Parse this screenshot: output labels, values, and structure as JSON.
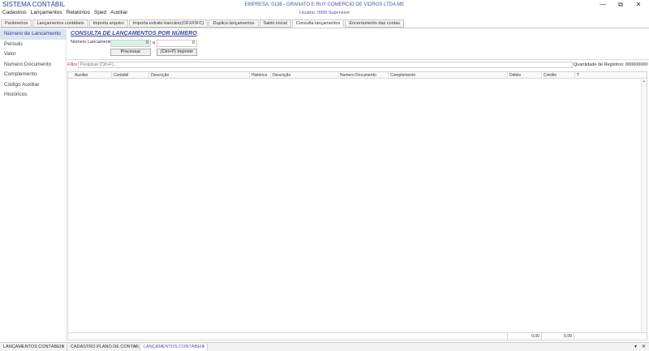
{
  "app": {
    "title": "SISTEMA CONTÁBIL",
    "company": "EMPRESA: 0138 - GRANATO E RUY COMERCIO DE VIDROS LTDA ME",
    "user": "Usuário: 9999 Supervisor"
  },
  "window_controls": {
    "minimize": "—",
    "restore": "⧉",
    "close": "✕"
  },
  "menu": [
    "Cadastros",
    "Lançamentos",
    "Relatórios",
    "Sped",
    "Auxiliar"
  ],
  "tabs": [
    {
      "label": "Parâmetros"
    },
    {
      "label": "Lançamentos contábeis"
    },
    {
      "label": "Importa arquivo"
    },
    {
      "label": "Importa extrato bancário(OFX/OFC)"
    },
    {
      "label": "Duplica lançamentos"
    },
    {
      "label": "Saldo inicial"
    },
    {
      "label": "Consulta lançamentos"
    },
    {
      "label": "Encerramento das contas"
    }
  ],
  "sidebar": [
    {
      "label": "Número de Lancamento"
    },
    {
      "label": "Período"
    },
    {
      "label": "Valor"
    },
    {
      "label": "Numero Documento"
    },
    {
      "label": "Complemento"
    },
    {
      "label": "Código Auxiliar"
    },
    {
      "label": "Históricos"
    }
  ],
  "form": {
    "section_title": "CONSULTA DE LANÇAMENTOS POR NÚMERO",
    "field_label": "Número Lancamento:",
    "from_value": "0",
    "separator": "a",
    "to_value": "0",
    "process_button": "Processar",
    "print_button": "(Ctrl+P) Imprimir"
  },
  "filter": {
    "label": "Filtro",
    "placeholder": "Pesquisar (Ctrl+F)...",
    "count_label": "Quantidade de Registros:",
    "count_value": "000000000"
  },
  "grid": {
    "columns": [
      "Auxiliar",
      "Contábil",
      "Descrição",
      "Histórico",
      "Descrição",
      "Numero Documento",
      "Complemento",
      "Débito",
      "Crédito",
      "T"
    ],
    "totals": {
      "debit": "0,00",
      "credit": "0,00"
    }
  },
  "bottom_tabs": [
    {
      "label": "LANÇAMENTOS CONTÁBEIS",
      "close": "×"
    },
    {
      "label": "CADASTRO PLANO DE CONTAS",
      "close": "×"
    },
    {
      "label": "LANÇAMENTOS CONTÁBEIS",
      "close": "×"
    }
  ],
  "bottom_controls": {
    "down": "▾",
    "close": "✕"
  }
}
